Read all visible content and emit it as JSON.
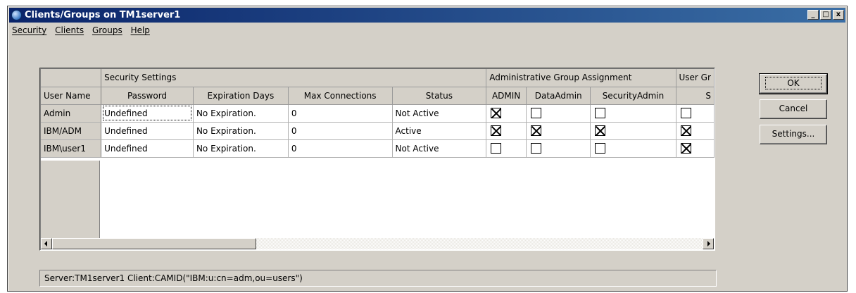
{
  "window": {
    "title": "Clients/Groups on TM1server1",
    "controls": {
      "minimize": "_",
      "maximize": "□",
      "close": "x"
    }
  },
  "menu": [
    "Security",
    "Clients",
    "Groups",
    "Help"
  ],
  "grid": {
    "group_headers": {
      "security": "Security Settings",
      "admin": "Administrative Group Assignment",
      "user": "User Gr"
    },
    "columns": {
      "user_name": "User Name",
      "password": "Password",
      "expiration": "Expiration Days",
      "max_connections": "Max Connections",
      "status": "Status",
      "admin": "ADMIN",
      "dataadmin": "DataAdmin",
      "securityadmin": "SecurityAdmin",
      "s": "S"
    },
    "rows": [
      {
        "user": "Admin",
        "password": "Undefined",
        "expiration": "No Expiration.",
        "max": "0",
        "status": "Not Active",
        "admin": true,
        "dataadmin": false,
        "securityadmin": false,
        "s": false
      },
      {
        "user": "IBM/ADM",
        "password": "Undefined",
        "expiration": "No Expiration.",
        "max": "0",
        "status": "Active",
        "admin": true,
        "dataadmin": true,
        "securityadmin": true,
        "s": true
      },
      {
        "user": "IBM\\user1",
        "password": "Undefined",
        "expiration": "No Expiration.",
        "max": "0",
        "status": "Not Active",
        "admin": false,
        "dataadmin": false,
        "securityadmin": false,
        "s": true
      }
    ]
  },
  "buttons": {
    "ok": "OK",
    "cancel": "Cancel",
    "settings": "Settings..."
  },
  "status": "Server:TM1server1  Client:CAMID(\"IBM:u:cn=adm,ou=users\")"
}
